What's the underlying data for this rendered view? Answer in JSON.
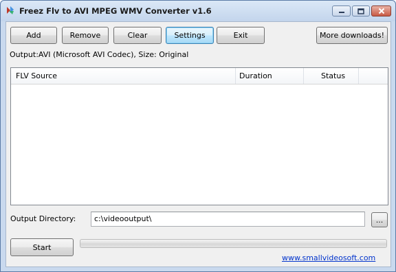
{
  "window": {
    "title": "Freez Flv to AVI MPEG WMV Converter v1.6"
  },
  "toolbar": {
    "add_label": "Add",
    "remove_label": "Remove",
    "clear_label": "Clear",
    "settings_label": "Settings",
    "exit_label": "Exit",
    "more_downloads_label": "More downloads!"
  },
  "status_line": "Output:AVI (Microsoft AVI Codec), Size: Original",
  "file_list": {
    "columns": [
      "FLV Source",
      "Duration",
      "Status"
    ],
    "rows": []
  },
  "output": {
    "label": "Output Directory:",
    "value": "c:\\videooutput\\",
    "browse_label": "..."
  },
  "start_label": "Start",
  "progress": {
    "value_percent": 0
  },
  "website_link": "www.smallvideosoft.com",
  "colors": {
    "focus_border": "#3c7fb1",
    "link": "#0033cc",
    "window_frame": "#c9d9ee"
  }
}
